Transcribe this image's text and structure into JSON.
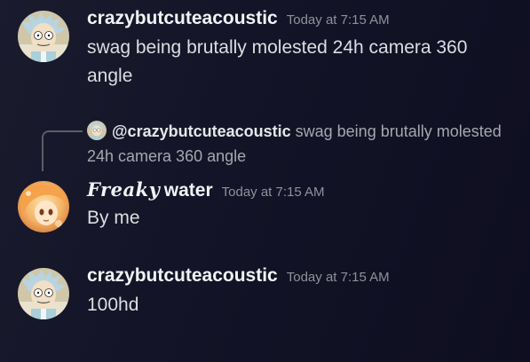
{
  "messages": [
    {
      "username": "crazybutcuteacoustic",
      "timestamp": "Today at 7:15 AM",
      "content": "swag being brutally molested 24h camera 360 angle",
      "avatar_icon": "rick-avatar-icon"
    },
    {
      "reply": {
        "username": "@crazybutcuteacoustic",
        "snippet": "swag being brutally molested 24h camera 360 angle",
        "avatar_icon": "rick-avatar-icon"
      },
      "username_fancy": "Freaky",
      "username_rest": "water",
      "timestamp": "Today at 7:15 AM",
      "content": "By me",
      "avatar_icon": "anime-avatar-icon"
    },
    {
      "username": "crazybutcuteacoustic",
      "timestamp": "Today at 7:15 AM",
      "content": "100hd",
      "avatar_icon": "rick-avatar-icon"
    }
  ],
  "colors": {
    "background": "#141428",
    "username": "#f2f3f5",
    "timestamp": "#8e9297",
    "text": "#dbdee1"
  }
}
